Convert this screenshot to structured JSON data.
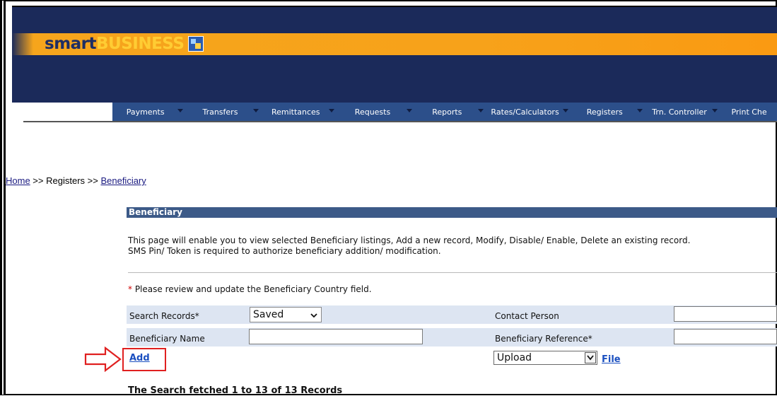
{
  "brand": {
    "smart": "smart",
    "business": "BUSINESS",
    "accent": "#f6a51c",
    "header_color": "#1b2a5a"
  },
  "nav": {
    "items": [
      {
        "label": "Payments",
        "width": 107
      },
      {
        "label": "Transfers",
        "width": 108
      },
      {
        "label": "Remittances",
        "width": 109
      },
      {
        "label": "Requests",
        "width": 112
      },
      {
        "label": "Reports",
        "width": 102
      },
      {
        "label": "Rates/Calculators",
        "width": 122
      },
      {
        "label": "Registers",
        "width": 107
      },
      {
        "label": "Trn. Controller",
        "width": 108
      },
      {
        "label": "Print Che",
        "width": 80
      }
    ],
    "bg": "#2c4f8a"
  },
  "breadcrumb": {
    "home": "Home",
    "sep1": " >> ",
    "registers": "Registers",
    "sep2": " >> ",
    "current": "Beneficiary"
  },
  "section": {
    "title": "Beneficiary"
  },
  "description": {
    "line1": "This page will enable you to view selected Beneficiary listings, Add a new record, Modify, Disable/ Enable, Delete an existing record.",
    "line2": "SMS Pin/ Token is required to authorize beneficiary addition/ modification."
  },
  "note": {
    "star": "*",
    "text": " Please review and update the Beneficiary Country field."
  },
  "form": {
    "search_records_label": "Search Records*",
    "search_records_value": "Saved",
    "contact_person_label": "Contact Person",
    "contact_person_value": "",
    "beneficiary_name_label": "Beneficiary Name",
    "beneficiary_name_value": "",
    "beneficiary_reference_label": "Beneficiary Reference*",
    "beneficiary_reference_value": ""
  },
  "actions": {
    "add": "Add",
    "upload_value": "Upload",
    "file": "File"
  },
  "results": {
    "fetched": "The Search fetched 1 to 13 of 13 Records"
  },
  "icons": {
    "pointer_arrow": "red-outline-arrow-right-icon",
    "dropdown": "chevron-down-icon",
    "logo_mark": "smartbusiness-logo-icon"
  }
}
